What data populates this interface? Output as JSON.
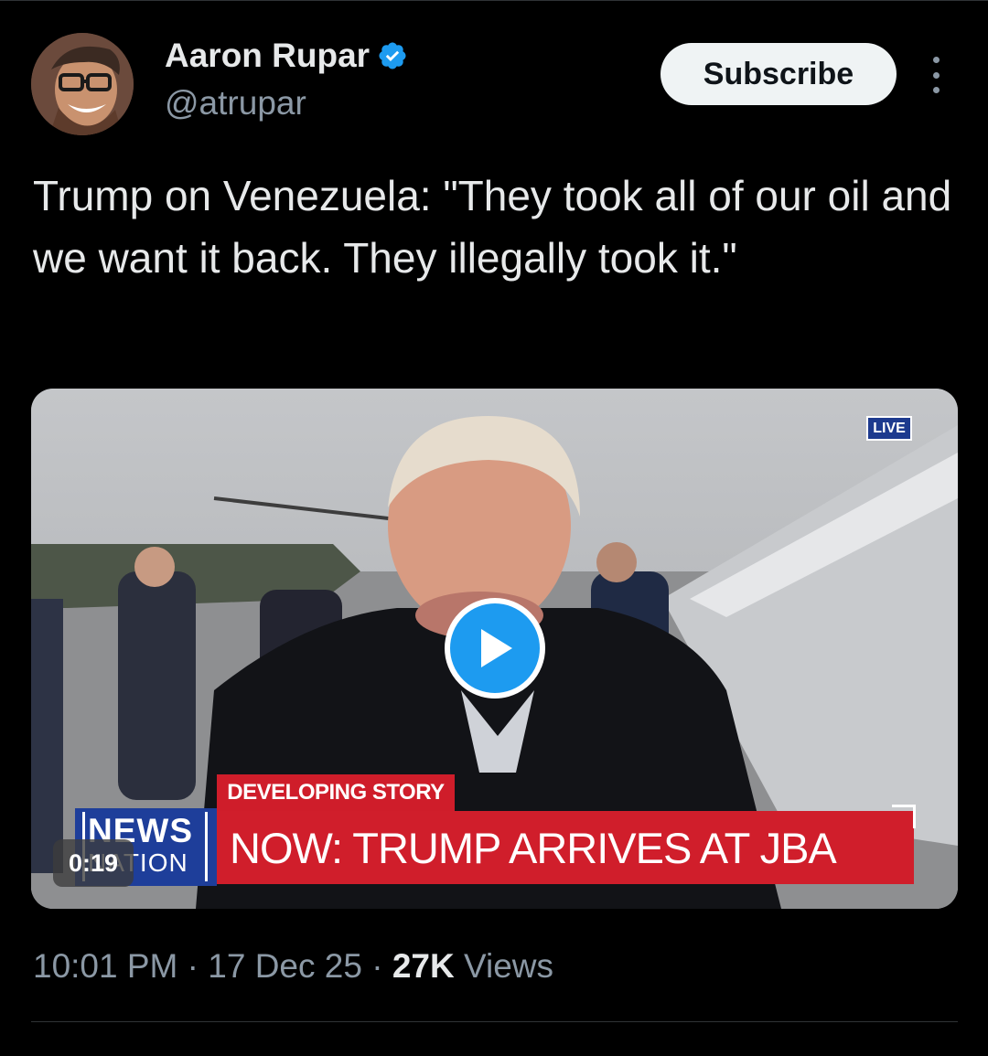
{
  "author": {
    "name": "Aaron Rupar",
    "handle": "@atrupar",
    "verified_icon": "verified-badge-icon"
  },
  "actions": {
    "subscribe_label": "Subscribe",
    "more_icon": "more-options-icon"
  },
  "tweet": {
    "text": "Trump on Venezuela: \"They took all of our oil and we want it back. They illegally took it.\""
  },
  "media": {
    "live_label": "LIVE",
    "play_icon": "play-icon",
    "lower_third": {
      "tag": "DEVELOPING STORY",
      "headline": "NOW: TRUMP ARRIVES AT JBA"
    },
    "network_logo": {
      "line1": "NEWS",
      "line2": "NATION"
    },
    "duration": "0:19"
  },
  "meta": {
    "time": "10:01 PM",
    "separator": "·",
    "date": "17 Dec 25",
    "views_count": "27K",
    "views_label": "Views"
  },
  "colors": {
    "background": "#000000",
    "accent": "#1d9bf0",
    "news_red": "#d01e2b",
    "news_blue": "#1e3e9a"
  }
}
